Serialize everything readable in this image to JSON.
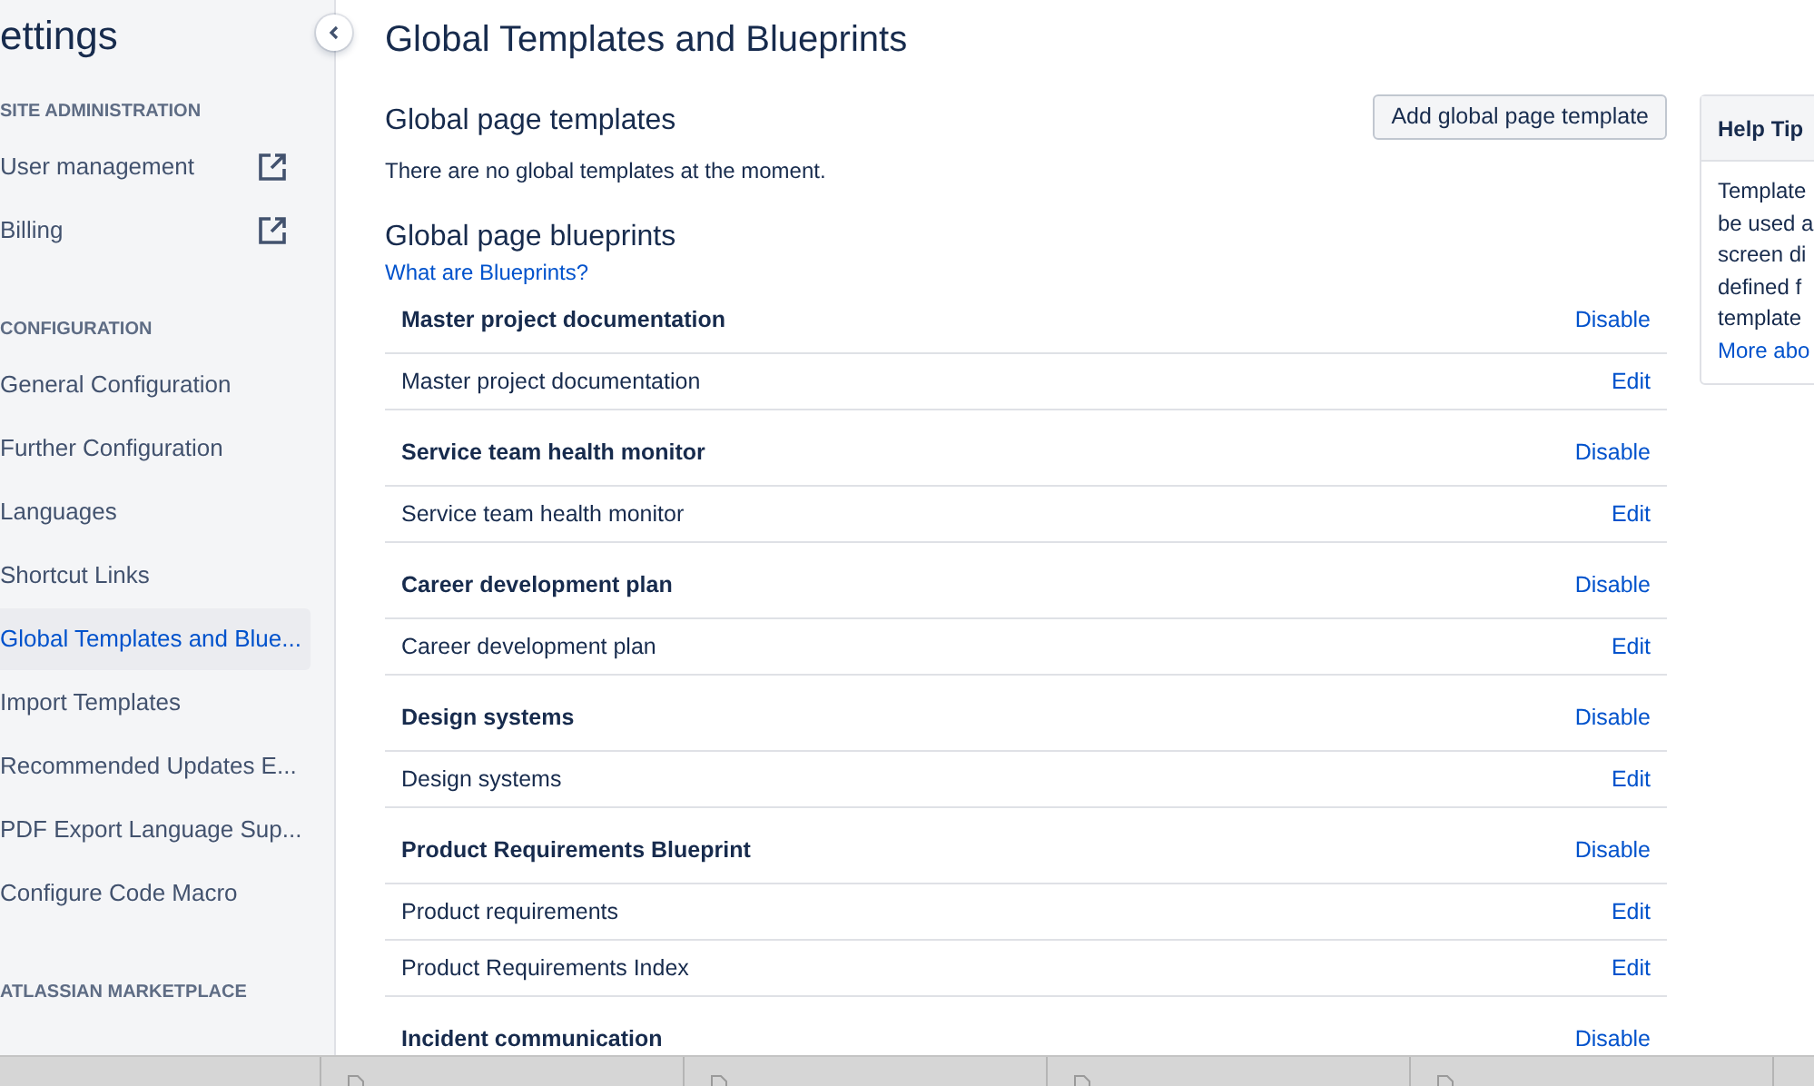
{
  "sidebar": {
    "title": "ettings",
    "sections": [
      {
        "heading": "SITE ADMINISTRATION",
        "items": [
          {
            "label": "User management",
            "external": true,
            "selected": false
          },
          {
            "label": "Billing",
            "external": true,
            "selected": false
          }
        ]
      },
      {
        "heading": "CONFIGURATION",
        "items": [
          {
            "label": "General Configuration",
            "external": false,
            "selected": false
          },
          {
            "label": "Further Configuration",
            "external": false,
            "selected": false
          },
          {
            "label": "Languages",
            "external": false,
            "selected": false
          },
          {
            "label": "Shortcut Links",
            "external": false,
            "selected": false
          },
          {
            "label": "Global Templates and Blue...",
            "external": false,
            "selected": true
          },
          {
            "label": "Import Templates",
            "external": false,
            "selected": false
          },
          {
            "label": "Recommended Updates E...",
            "external": false,
            "selected": false
          },
          {
            "label": "PDF Export Language Sup...",
            "external": false,
            "selected": false
          },
          {
            "label": "Configure Code Macro",
            "external": false,
            "selected": false
          }
        ]
      },
      {
        "heading": "ATLASSIAN MARKETPLACE"
      }
    ]
  },
  "page_title": "Global Templates and Blueprints",
  "templates": {
    "heading": "Global page templates",
    "empty_message": "There are no global templates at the moment.",
    "add_button": "Add global page template"
  },
  "blueprints": {
    "heading": "Global page blueprints",
    "help_link": "What are Blueprints?",
    "groups": [
      {
        "title": "Master project documentation",
        "action": "Disable",
        "templates": [
          {
            "name": "Master project documentation",
            "action": "Edit"
          }
        ]
      },
      {
        "title": "Service team health monitor",
        "action": "Disable",
        "templates": [
          {
            "name": "Service team health monitor",
            "action": "Edit"
          }
        ]
      },
      {
        "title": "Career development plan",
        "action": "Disable",
        "templates": [
          {
            "name": "Career development plan",
            "action": "Edit"
          }
        ]
      },
      {
        "title": "Design systems",
        "action": "Disable",
        "templates": [
          {
            "name": "Design systems",
            "action": "Edit"
          }
        ]
      },
      {
        "title": "Product Requirements Blueprint",
        "action": "Disable",
        "templates": [
          {
            "name": "Product requirements",
            "action": "Edit"
          },
          {
            "name": "Product Requirements Index",
            "action": "Edit"
          }
        ]
      },
      {
        "title": "Incident communication",
        "action": "Disable"
      }
    ]
  },
  "help_tips": {
    "title": "Help Tip",
    "lines": [
      "Template",
      "be used a",
      "screen di",
      "defined f",
      "template"
    ],
    "link": "More abo"
  },
  "download_bar": {
    "items": [
      {
        "kind": "file"
      },
      {
        "kind": "file"
      },
      {
        "kind": "file"
      },
      {
        "kind": "file"
      }
    ]
  }
}
